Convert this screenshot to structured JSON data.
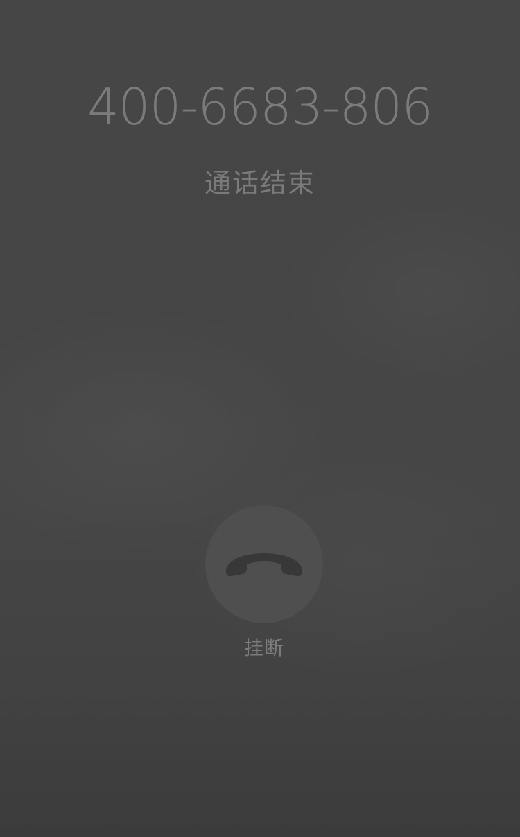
{
  "call": {
    "phone_number": "400-6683-806",
    "status": "通话结束"
  },
  "controls": {
    "hangup_label": "挂断",
    "hangup_icon": "phone-hangup-icon"
  }
}
